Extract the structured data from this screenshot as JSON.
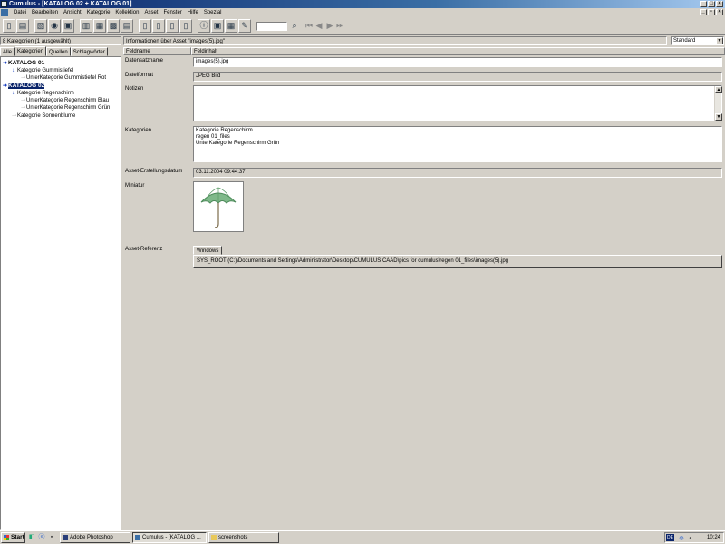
{
  "window": {
    "title": "Cumulus - [KATALOG 02 + KATALOG 01]"
  },
  "menu": [
    "Datei",
    "Bearbeiten",
    "Ansicht",
    "Kategorie",
    "Kollektion",
    "Asset",
    "Fenster",
    "Hilfe",
    "Spezial"
  ],
  "left_panel": {
    "status": "8 Kategorien (1 ausgewählt)",
    "tabs": [
      "Alle",
      "Kategorien",
      "Quellen",
      "Schlagwörter"
    ],
    "tree": [
      {
        "label": "KATALOG 01",
        "level": 0,
        "bold": true,
        "selected": false,
        "icon": "blue-down-arrow-icon"
      },
      {
        "label": "Kategorie Gummistiefel",
        "level": 1,
        "bold": false,
        "selected": false,
        "icon": "blue-down-arrow-icon"
      },
      {
        "label": "UnterKategorie Gummistiefel Rot",
        "level": 2,
        "bold": false,
        "selected": false,
        "icon": "gray-arrow-icon"
      },
      {
        "label": "KATALOG 02",
        "level": 0,
        "bold": true,
        "selected": true,
        "icon": "blue-down-arrow-icon"
      },
      {
        "label": "Kategorie Regenschirm",
        "level": 1,
        "bold": false,
        "selected": false,
        "icon": "blue-down-arrow-icon"
      },
      {
        "label": "UnterKategorie Regenschirm Blau",
        "level": 2,
        "bold": false,
        "selected": false,
        "icon": "gray-arrow-icon"
      },
      {
        "label": "UnterKategorie Regenschirm Grün",
        "level": 2,
        "bold": false,
        "selected": false,
        "icon": "gray-arrow-icon"
      },
      {
        "label": "Kategorie Sonnenblume",
        "level": 1,
        "bold": false,
        "selected": false,
        "icon": "gray-arrow-icon"
      }
    ]
  },
  "right_panel": {
    "header": "Informationen über Asset \"images(5).jpg\"",
    "view_select": "Standard",
    "columns": [
      "Feldname",
      "Feldinhalt"
    ],
    "fields": {
      "name_label": "Datensatzname",
      "name_value": "images(5).jpg",
      "format_label": "Dateiformat",
      "format_value": "JPEG Bild",
      "notes_label": "Notizen",
      "notes_value": "",
      "categories_label": "Kategorien",
      "categories_lines": [
        "Kategorie Regenschirm",
        "regen 01_files",
        "UnterKategorie Regenschirm Grün"
      ],
      "created_label": "Asset-Erstellungsdatum",
      "created_value": "03.11.2004 09:44:37",
      "thumb_label": "Miniatur",
      "ref_label": "Asset-Referenz",
      "ref_tab": "Windows",
      "ref_value": "SYS_ROOT (C:)\\Documents and Settings\\Administrator\\Desktop\\CUMULUS CAAD\\pics for cumulus\\regen 01_files\\images(5).jpg"
    }
  },
  "taskbar": {
    "start": "Start",
    "tasks": [
      "Adobe Photoshop",
      "Cumulus - [KATALOG ...",
      "screenshots"
    ],
    "lang": "DE",
    "clock": "10:24"
  }
}
